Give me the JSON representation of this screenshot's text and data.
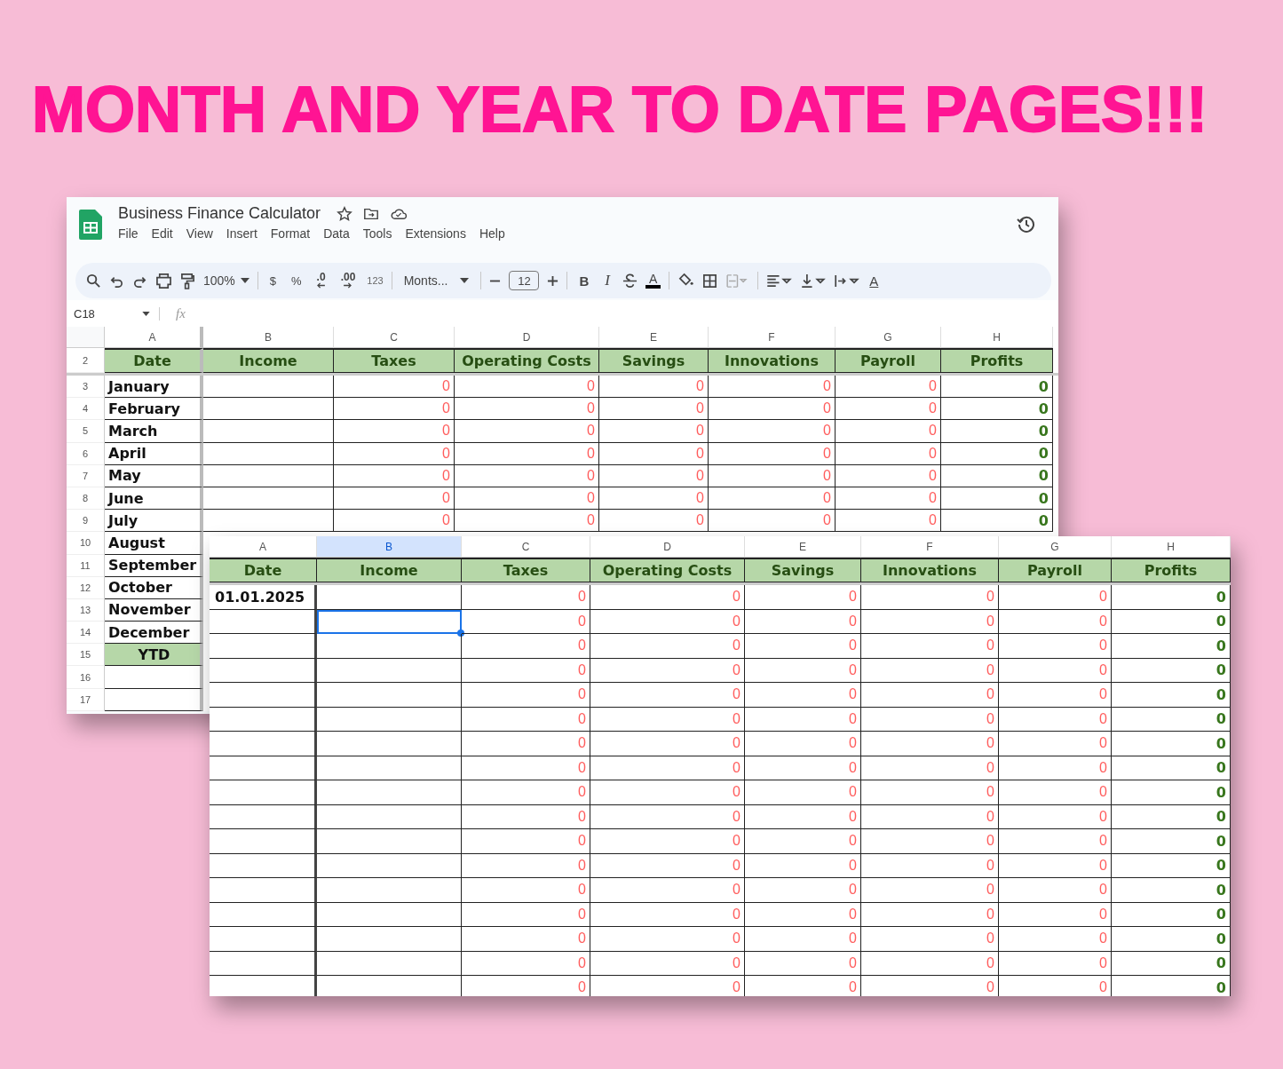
{
  "headline": "MONTH AND YEAR TO DATE PAGES!!!",
  "back_sheet": {
    "title": "Business Finance Calculator",
    "menu": [
      "File",
      "Edit",
      "View",
      "Insert",
      "Format",
      "Data",
      "Tools",
      "Extensions",
      "Help"
    ],
    "toolbar": {
      "zoom": "100%",
      "currency": "$",
      "percent": "%",
      "decrease_decimals": ".0",
      "increase_decimals": ".00",
      "number_format": "123",
      "font": "Monts...",
      "font_size": "12",
      "bold": "B",
      "italic": "I",
      "text_color": "A",
      "text_rotation": "A"
    },
    "name_box": "C18",
    "formula_label": "fx",
    "columns": [
      {
        "letter": "A",
        "heading": "Date"
      },
      {
        "letter": "B",
        "heading": "Income"
      },
      {
        "letter": "C",
        "heading": "Taxes"
      },
      {
        "letter": "D",
        "heading": "Operating Costs"
      },
      {
        "letter": "E",
        "heading": "Savings"
      },
      {
        "letter": "F",
        "heading": "Innovations"
      },
      {
        "letter": "G",
        "heading": "Payroll"
      },
      {
        "letter": "H",
        "heading": "Profits"
      }
    ],
    "heading_row_number": "2",
    "rows": [
      {
        "number": "3",
        "kind": "month",
        "date": "January",
        "values": [
          "0",
          "0",
          "0",
          "0",
          "0"
        ],
        "profit": "0"
      },
      {
        "number": "4",
        "kind": "month",
        "date": "February",
        "values": [
          "0",
          "0",
          "0",
          "0",
          "0"
        ],
        "profit": "0"
      },
      {
        "number": "5",
        "kind": "month",
        "date": "March",
        "values": [
          "0",
          "0",
          "0",
          "0",
          "0"
        ],
        "profit": "0"
      },
      {
        "number": "6",
        "kind": "month",
        "date": "April",
        "values": [
          "0",
          "0",
          "0",
          "0",
          "0"
        ],
        "profit": "0"
      },
      {
        "number": "7",
        "kind": "month",
        "date": "May",
        "values": [
          "0",
          "0",
          "0",
          "0",
          "0"
        ],
        "profit": "0"
      },
      {
        "number": "8",
        "kind": "month",
        "date": "June",
        "values": [
          "0",
          "0",
          "0",
          "0",
          "0"
        ],
        "profit": "0"
      },
      {
        "number": "9",
        "kind": "month",
        "date": "July",
        "values": [
          "0",
          "0",
          "0",
          "0",
          "0"
        ],
        "profit": "0"
      },
      {
        "number": "10",
        "kind": "month",
        "date": "August"
      },
      {
        "number": "11",
        "kind": "month",
        "date": "September"
      },
      {
        "number": "12",
        "kind": "month",
        "date": "October"
      },
      {
        "number": "13",
        "kind": "month",
        "date": "November"
      },
      {
        "number": "14",
        "kind": "month",
        "date": "December"
      },
      {
        "number": "15",
        "kind": "total",
        "date": "YTD"
      },
      {
        "number": "16",
        "kind": "blank"
      },
      {
        "number": "17",
        "kind": "blank"
      }
    ]
  },
  "front_sheet": {
    "columns": [
      {
        "letter": "A",
        "heading": "Date",
        "selected": false
      },
      {
        "letter": "B",
        "heading": "Income",
        "selected": true
      },
      {
        "letter": "C",
        "heading": "Taxes",
        "selected": false
      },
      {
        "letter": "D",
        "heading": "Operating Costs",
        "selected": false
      },
      {
        "letter": "E",
        "heading": "Savings",
        "selected": false
      },
      {
        "letter": "F",
        "heading": "Innovations",
        "selected": false
      },
      {
        "letter": "G",
        "heading": "Payroll",
        "selected": false
      },
      {
        "letter": "H",
        "heading": "Profits",
        "selected": false
      }
    ],
    "rows": [
      {
        "date": "01.01.2025",
        "income_selected": false,
        "values": [
          "0",
          "0",
          "0",
          "0",
          "0"
        ],
        "profit": "0"
      },
      {
        "income_selected": true,
        "values": [
          "0",
          "0",
          "0",
          "0",
          "0"
        ],
        "profit": "0"
      },
      {
        "income_selected": false,
        "values": [
          "0",
          "0",
          "0",
          "0",
          "0"
        ],
        "profit": "0"
      },
      {
        "income_selected": false,
        "values": [
          "0",
          "0",
          "0",
          "0",
          "0"
        ],
        "profit": "0"
      },
      {
        "income_selected": false,
        "values": [
          "0",
          "0",
          "0",
          "0",
          "0"
        ],
        "profit": "0"
      },
      {
        "income_selected": false,
        "values": [
          "0",
          "0",
          "0",
          "0",
          "0"
        ],
        "profit": "0"
      },
      {
        "income_selected": false,
        "values": [
          "0",
          "0",
          "0",
          "0",
          "0"
        ],
        "profit": "0"
      },
      {
        "income_selected": false,
        "values": [
          "0",
          "0",
          "0",
          "0",
          "0"
        ],
        "profit": "0"
      },
      {
        "income_selected": false,
        "values": [
          "0",
          "0",
          "0",
          "0",
          "0"
        ],
        "profit": "0"
      },
      {
        "income_selected": false,
        "values": [
          "0",
          "0",
          "0",
          "0",
          "0"
        ],
        "profit": "0"
      },
      {
        "income_selected": false,
        "values": [
          "0",
          "0",
          "0",
          "0",
          "0"
        ],
        "profit": "0"
      },
      {
        "income_selected": false,
        "values": [
          "0",
          "0",
          "0",
          "0",
          "0"
        ],
        "profit": "0"
      },
      {
        "income_selected": false,
        "values": [
          "0",
          "0",
          "0",
          "0",
          "0"
        ],
        "profit": "0"
      },
      {
        "income_selected": false,
        "values": [
          "0",
          "0",
          "0",
          "0",
          "0"
        ],
        "profit": "0"
      },
      {
        "income_selected": false,
        "values": [
          "0",
          "0",
          "0",
          "0",
          "0"
        ],
        "profit": "0"
      },
      {
        "income_selected": false,
        "values": [
          "0",
          "0",
          "0",
          "0",
          "0"
        ],
        "profit": "0"
      },
      {
        "income_selected": false,
        "values": [
          "0",
          "0",
          "0",
          "0",
          "0"
        ],
        "profit": "0"
      }
    ]
  }
}
